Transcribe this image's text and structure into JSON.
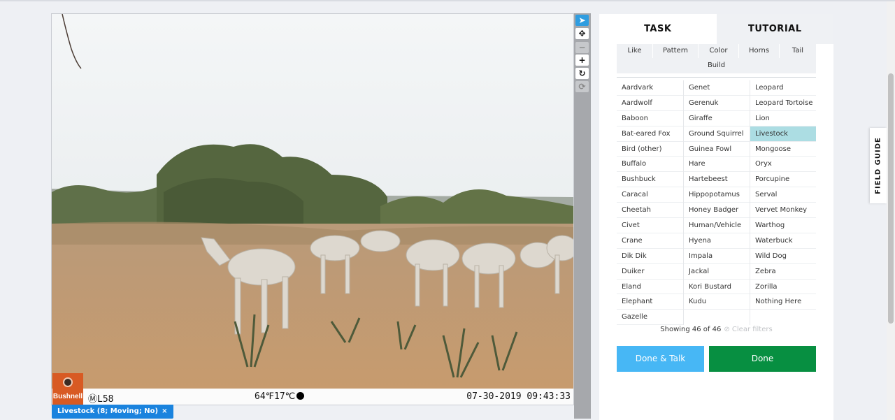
{
  "annotation": {
    "label": "Livestock (8; Moving; No)",
    "remove_glyph": "×"
  },
  "image_stamp": {
    "brand": "Bushnell",
    "camera_glyph": "Ⓜ",
    "camera_id": "L58",
    "temperature": "64℉17℃",
    "datetime": "07-30-2019 09:43:33"
  },
  "toolbar": {
    "select_glyph": "➤",
    "move_glyph": "✥",
    "zoom_out_glyph": "−",
    "zoom_in_glyph": "+",
    "rotate_glyph": "↻",
    "reset_glyph": "⟳"
  },
  "tabs": {
    "task": "TASK",
    "tutorial": "TUTORIAL"
  },
  "filters": [
    "Like",
    "Pattern",
    "Color",
    "Horns",
    "Tail",
    "Build"
  ],
  "choices": {
    "col1": [
      "Aardvark",
      "Aardwolf",
      "Baboon",
      "Bat-eared Fox",
      "Bird (other)",
      "Buffalo",
      "Bushbuck",
      "Caracal",
      "Cheetah",
      "Civet",
      "Crane",
      "Dik Dik",
      "Duiker",
      "Eland",
      "Elephant",
      "Gazelle"
    ],
    "col2": [
      "Genet",
      "Gerenuk",
      "Giraffe",
      "Ground Squirrel",
      "Guinea Fowl",
      "Hare",
      "Hartebeest",
      "Hippopotamus",
      "Honey Badger",
      "Human/Vehicle",
      "Hyena",
      "Impala",
      "Jackal",
      "Kori Bustard",
      "Kudu"
    ],
    "col3": [
      "Leopard",
      "Leopard Tortoise",
      "Lion",
      "Livestock",
      "Mongoose",
      "Oryx",
      "Porcupine",
      "Serval",
      "Vervet Monkey",
      "Warthog",
      "Waterbuck",
      "Wild Dog",
      "Zebra",
      "Zorilla",
      "Nothing Here"
    ]
  },
  "selected_choice": "Livestock",
  "showing_text": "Showing 46 of 46",
  "clear_filters": "⊘ Clear filters",
  "buttons": {
    "done_talk": "Done & Talk",
    "done": "Done"
  },
  "field_guide": "FIELD GUIDE",
  "colors": {
    "accent": "#1a83de",
    "done": "#078f41",
    "done_talk": "#47b7f5",
    "selected": "#acdde3"
  }
}
